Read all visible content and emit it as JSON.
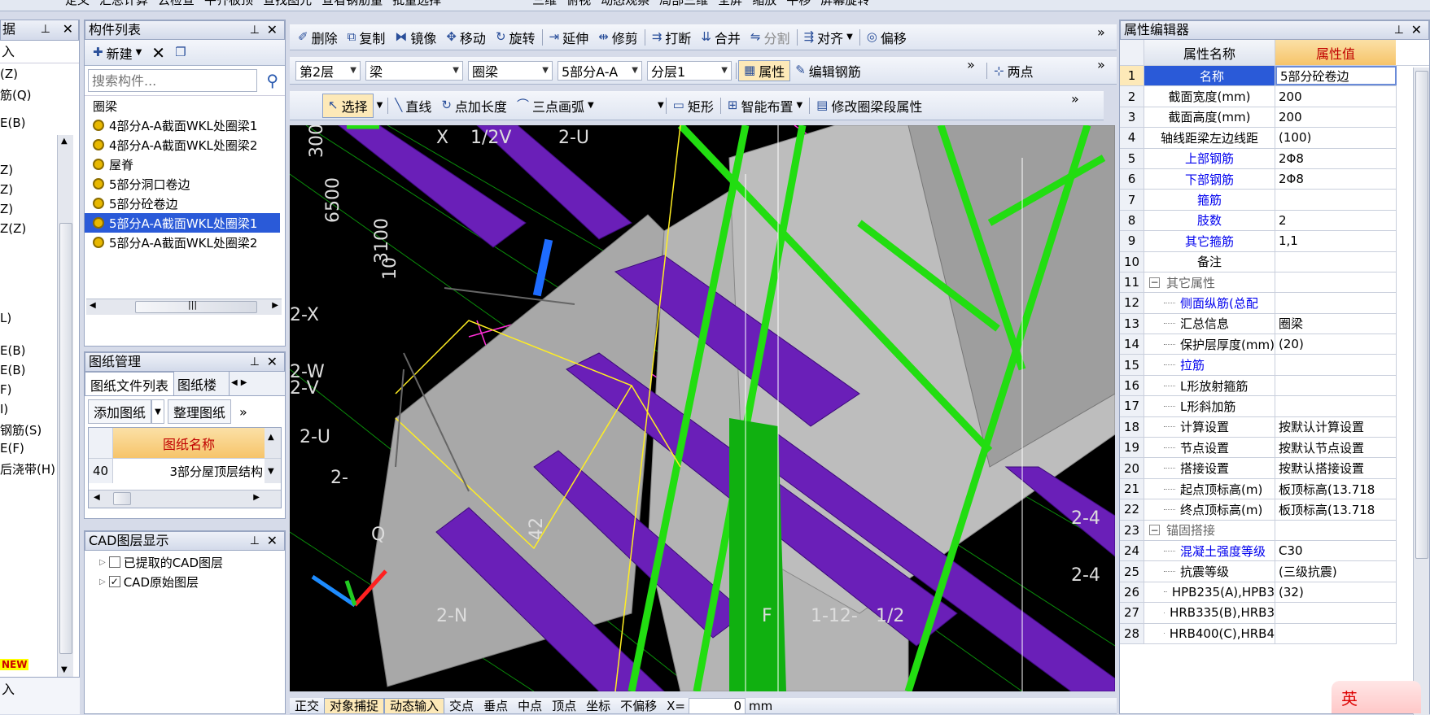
{
  "top_toolbar": {
    "items": [
      "定义",
      "汇总计算",
      "云检查",
      "平齐板顶",
      "查找图元",
      "查看钢筋量",
      "批量选择"
    ],
    "right_items": [
      "三维",
      "俯视",
      "动态观察",
      "局部三维",
      "全屏",
      "缩放",
      "平移",
      "屏幕旋转"
    ]
  },
  "left_panel": {
    "items": [
      "(Z)",
      "筋(Q)",
      "E(B)",
      "Z)",
      "Z)",
      "Z)",
      "Z(Z)",
      "L)",
      "E(B)",
      "E(B)",
      "F)",
      "I)",
      "钢筋(S)",
      "E(F)",
      "后浇带(H)"
    ],
    "new_badge": "NEW",
    "bottom_label": "入"
  },
  "component_list": {
    "title": "构件列表",
    "new_label": "新建",
    "search_placeholder": "搜索构件...",
    "root": "圈梁",
    "items": [
      "4部分A-A截面WKL处圈梁1",
      "4部分A-A截面WKL处圈梁2",
      "屋脊",
      "5部分洞口卷边",
      "5部分砼卷边",
      "5部分A-A截面WKL处圈梁1",
      "5部分A-A截面WKL处圈梁2"
    ],
    "selected_index": 5
  },
  "drawing_mgmt": {
    "title": "图纸管理",
    "tabs": [
      "图纸文件列表",
      "图纸楼"
    ],
    "add_label": "添加图纸",
    "organize_label": "整理图纸",
    "col_header": "图纸名称",
    "row_num": "40",
    "row_value": "3部分屋顶层结构"
  },
  "cad_layers": {
    "title": "CAD图层显示",
    "items": [
      {
        "label": "已提取的CAD图层",
        "checked": false
      },
      {
        "label": "CAD原始图层",
        "checked": true
      }
    ]
  },
  "edit_toolbar": {
    "items": [
      "删除",
      "复制",
      "镜像",
      "移动",
      "旋转",
      "延伸",
      "修剪",
      "打断",
      "合并",
      "分割",
      "对齐",
      "偏移"
    ]
  },
  "layer_toolbar": {
    "floor": "第2层",
    "type": "梁",
    "subtype": "圈梁",
    "component": "5部分A-A",
    "sublayer": "分层1",
    "property_label": "属性",
    "edit_rebar_label": "编辑钢筋",
    "two_point_label": "两点"
  },
  "draw_toolbar": {
    "select_label": "选择",
    "line_label": "直线",
    "point_length_label": "点加长度",
    "arc_label": "三点画弧",
    "rect_label": "矩形",
    "smart_label": "智能布置",
    "modify_label": "修改圈梁段属性"
  },
  "viewport": {
    "labels": [
      "300",
      "6500",
      "3100",
      "10",
      "X",
      "1/2V",
      "2-U",
      "2-X",
      "2-W",
      "2-V",
      "2-U",
      "2-",
      "Q",
      "2-N",
      "42",
      "F",
      "1-12-",
      "1/2",
      "2-4",
      "2-4"
    ]
  },
  "bottom_toolbar": {
    "items": [
      "正交",
      "对象捕捉",
      "动态输入",
      "交点",
      "垂点",
      "中点",
      "顶点",
      "坐标",
      "不偏移"
    ],
    "x_label": "X=",
    "x_value": "0",
    "unit": "mm"
  },
  "property_editor": {
    "title": "属性编辑器",
    "col_name": "属性名称",
    "col_value": "属性值",
    "rows": [
      {
        "num": "1",
        "name": "名称",
        "value": "5部分砼卷边",
        "style": "blue",
        "selected": true
      },
      {
        "num": "2",
        "name": "截面宽度(mm)",
        "value": "200",
        "style": "",
        "indent": 0
      },
      {
        "num": "3",
        "name": "截面高度(mm)",
        "value": "200",
        "style": ""
      },
      {
        "num": "4",
        "name": "轴线距梁左边线距",
        "value": "(100)",
        "style": ""
      },
      {
        "num": "5",
        "name": "上部钢筋",
        "value": "2Φ8",
        "style": "blue"
      },
      {
        "num": "6",
        "name": "下部钢筋",
        "value": "2Φ8",
        "style": "blue"
      },
      {
        "num": "7",
        "name": "箍筋",
        "value": "",
        "style": "blue"
      },
      {
        "num": "8",
        "name": "肢数",
        "value": "2",
        "style": "blue"
      },
      {
        "num": "9",
        "name": "其它箍筋",
        "value": "1,1",
        "style": "blue"
      },
      {
        "num": "10",
        "name": "备注",
        "value": "",
        "style": ""
      },
      {
        "num": "11",
        "name": "其它属性",
        "value": "",
        "style": "group"
      },
      {
        "num": "12",
        "name": "侧面纵筋(总配",
        "value": "",
        "style": "blue-indent"
      },
      {
        "num": "13",
        "name": "汇总信息",
        "value": "圈梁",
        "style": "indent"
      },
      {
        "num": "14",
        "name": "保护层厚度(mm)",
        "value": "(20)",
        "style": "indent"
      },
      {
        "num": "15",
        "name": "拉筋",
        "value": "",
        "style": "blue-indent"
      },
      {
        "num": "16",
        "name": "L形放射箍筋",
        "value": "",
        "style": "indent"
      },
      {
        "num": "17",
        "name": "L形斜加筋",
        "value": "",
        "style": "indent"
      },
      {
        "num": "18",
        "name": "计算设置",
        "value": "按默认计算设置",
        "style": "indent"
      },
      {
        "num": "19",
        "name": "节点设置",
        "value": "按默认节点设置",
        "style": "indent"
      },
      {
        "num": "20",
        "name": "搭接设置",
        "value": "按默认搭接设置",
        "style": "indent"
      },
      {
        "num": "21",
        "name": "起点顶标高(m)",
        "value": "板顶标高(13.718",
        "style": "indent"
      },
      {
        "num": "22",
        "name": "终点顶标高(m)",
        "value": "板顶标高(13.718",
        "style": "indent"
      },
      {
        "num": "23",
        "name": "锚固搭接",
        "value": "",
        "style": "group"
      },
      {
        "num": "24",
        "name": "混凝土强度等级",
        "value": "C30",
        "style": "blue-indent"
      },
      {
        "num": "25",
        "name": "抗震等级",
        "value": "(三级抗震)",
        "style": "indent"
      },
      {
        "num": "26",
        "name": "HPB235(A),HPB3",
        "value": "(32)",
        "style": "indent"
      },
      {
        "num": "27",
        "name": "HRB335(B),HRB3",
        "value": "",
        "style": "indent"
      },
      {
        "num": "28",
        "name": "HRB400(C),HRB4",
        "value": "",
        "style": "indent"
      }
    ],
    "ime_label": "英"
  }
}
